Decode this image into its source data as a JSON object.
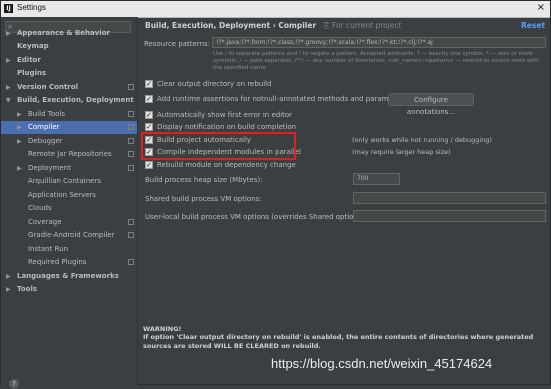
{
  "window": {
    "title": "Settings",
    "app_icon": "IJ"
  },
  "sidebar": {
    "search_placeholder": "",
    "items": [
      {
        "label": "Appearance & Behavior",
        "bold": true,
        "arrow": "▶"
      },
      {
        "label": "Keymap",
        "bold": true,
        "arrow": ""
      },
      {
        "label": "Editor",
        "bold": true,
        "arrow": "▶"
      },
      {
        "label": "Plugins",
        "bold": true,
        "arrow": ""
      },
      {
        "label": "Version Control",
        "bold": true,
        "arrow": "▶"
      },
      {
        "label": "Build, Execution, Deployment",
        "bold": true,
        "arrow": "▼"
      },
      {
        "label": "Build Tools",
        "arrow": "▶"
      },
      {
        "label": "Compiler",
        "arrow": "▶"
      },
      {
        "label": "Debugger",
        "arrow": "▶"
      },
      {
        "label": "Remote Jar Repositories",
        "arrow": ""
      },
      {
        "label": "Deployment",
        "arrow": "▶"
      },
      {
        "label": "Arquillian Containers",
        "arrow": ""
      },
      {
        "label": "Application Servers",
        "arrow": ""
      },
      {
        "label": "Clouds",
        "arrow": ""
      },
      {
        "label": "Coverage",
        "arrow": ""
      },
      {
        "label": "Gradle-Android Compiler",
        "arrow": ""
      },
      {
        "label": "Instant Run",
        "arrow": ""
      },
      {
        "label": "Required Plugins",
        "arrow": ""
      },
      {
        "label": "Languages & Frameworks",
        "bold": true,
        "arrow": "▶"
      },
      {
        "label": "Tools",
        "bold": true,
        "arrow": "▶"
      }
    ],
    "help": "?"
  },
  "header": {
    "breadcrumb": "Build, Execution, Deployment › Compiler",
    "project_note": "For current project",
    "reset": "Reset"
  },
  "resource_patterns": {
    "label": "Resource patterns:",
    "value": "!?*.java;!?*.form;!?*.class;!?*.groovy;!?*.scala;!?*.flex;!?*.kt;!?*.clj;!?*.aj",
    "hint": "Use ; to separate patterns and ! to negate a pattern. Accepted wildcards: ? — exactly one symbol; * — zero or more symbols; / — path separator; /**/ — any number of directories; <dir_name>:<pattern> — restrict to source roots with the specified name"
  },
  "options": {
    "clear_output": "Clear output directory on rebuild",
    "add_assertions": "Add runtime assertions for notnull-annotated methods and parameters",
    "configure_annotations": "Configure annotations...",
    "show_first_error": "Automatically show first error in editor",
    "display_notification": "Display notification on build completion",
    "build_auto": "Build project automatically",
    "build_auto_note": "(only works while not running / debugging)",
    "compile_parallel": "Compile independent modules in parallel",
    "compile_parallel_note": "(may require larger heap size)",
    "rebuild_dependency": "Rebuild module on dependency change"
  },
  "heap": {
    "label": "Build process heap size (Mbytes):",
    "value": "700"
  },
  "shared_vm": {
    "label": "Shared build process VM options:",
    "value": ""
  },
  "user_vm": {
    "label": "User-local build process VM options (overrides Shared options):",
    "value": ""
  },
  "warning": {
    "title": "WARNING!",
    "text": "If option 'Clear output directory on rebuild' is enabled, the entire contents of directories where generated sources are stored WILL BE CLEARED on rebuild."
  },
  "watermark": "https://blog.csdn.net/weixin_45174624"
}
